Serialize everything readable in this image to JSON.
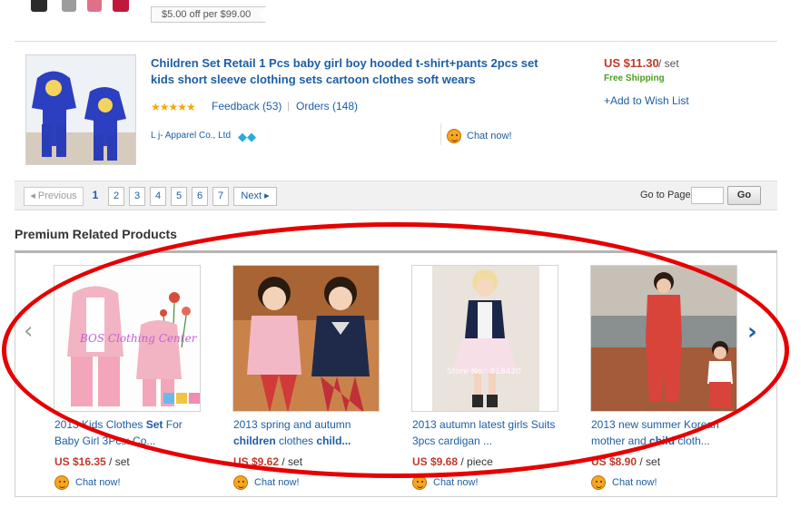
{
  "coupon": "$5.00 off per $99.00",
  "product": {
    "title": "Children Set Retail 1 Pcs baby girl boy hooded t-shirt+pants 2pcs set kids short sleeve clothing sets cartoon clothes soft wears",
    "rating_stars": "★★★★★",
    "feedback": "Feedback (53)",
    "separator": "|",
    "orders": "Orders (148)",
    "seller": "L j- Apparel Co., Ltd",
    "seller_badge": "◆◆",
    "chat": "Chat now!",
    "price": "US $11.30",
    "unit": "/ set",
    "shipping": "Free Shipping",
    "wishlist": "+Add to Wish List"
  },
  "pagination": {
    "previous": "◂ Previous",
    "pages": [
      "1",
      "2",
      "3",
      "4",
      "5",
      "6",
      "7"
    ],
    "current": "1",
    "next": "Next ▸",
    "goto_label": "Go to Page",
    "go_button": "Go"
  },
  "premium": {
    "heading": "Premium Related Products",
    "prev_arrow": "‹",
    "next_arrow": "›",
    "cards": [
      {
        "title_a": "2013 Kids Clothes ",
        "title_b": "Set",
        "title_c": " For Baby Girl 3Pcs: Co...",
        "price": "US $16.35",
        "unit": " / set",
        "chat": "Chat now!",
        "watermark": "BOS Clothing Center"
      },
      {
        "title_a": "2013 spring and autumn ",
        "title_b": "children",
        "title_c": " clothes ",
        "title_d": "child...",
        "price": "US $9.62",
        "unit": " / set",
        "chat": "Chat now!"
      },
      {
        "title_a": "2013 autumn latest girls Suits 3pcs cardigan ...",
        "price": "US $9.68",
        "unit": " / piece",
        "chat": "Chat now!",
        "watermark": "Store No.: 818420"
      },
      {
        "title_a": "2013 new summer Korean mother and ",
        "title_b": "child",
        "title_c": " cloth...",
        "price": "US $8.90",
        "unit": " / set",
        "chat": "Chat now!"
      }
    ]
  },
  "colors": {
    "link": "#1d5ea5",
    "price": "#c0392b",
    "annotation": "#e60000",
    "free_shipping": "#4b9e1e"
  }
}
